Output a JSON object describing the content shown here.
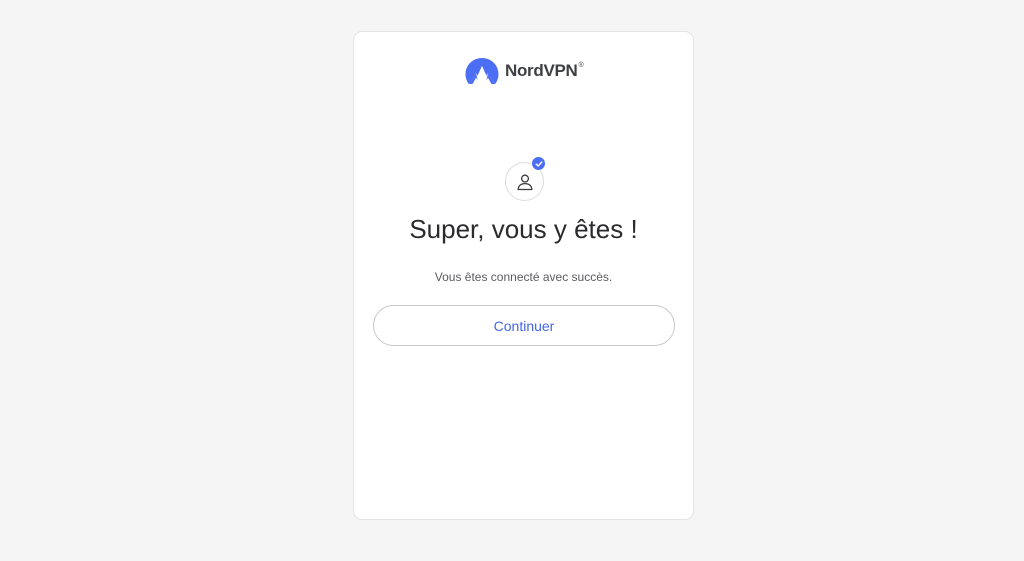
{
  "logo": {
    "brand_name": "NordVPN",
    "trademark": "®",
    "icon": "nordvpn-mountain-logo"
  },
  "status": {
    "icon": "user-icon",
    "badge_icon": "check-icon"
  },
  "main": {
    "title": "Super, vous y êtes !",
    "subtitle": "Vous êtes connecté avec succès.",
    "continue_label": "Continuer"
  },
  "colors": {
    "background": "#f5f5f5",
    "card": "#ffffff",
    "accent": "#4b6ef5",
    "button_text": "#4465e8",
    "title_text": "#2b2b2e"
  }
}
